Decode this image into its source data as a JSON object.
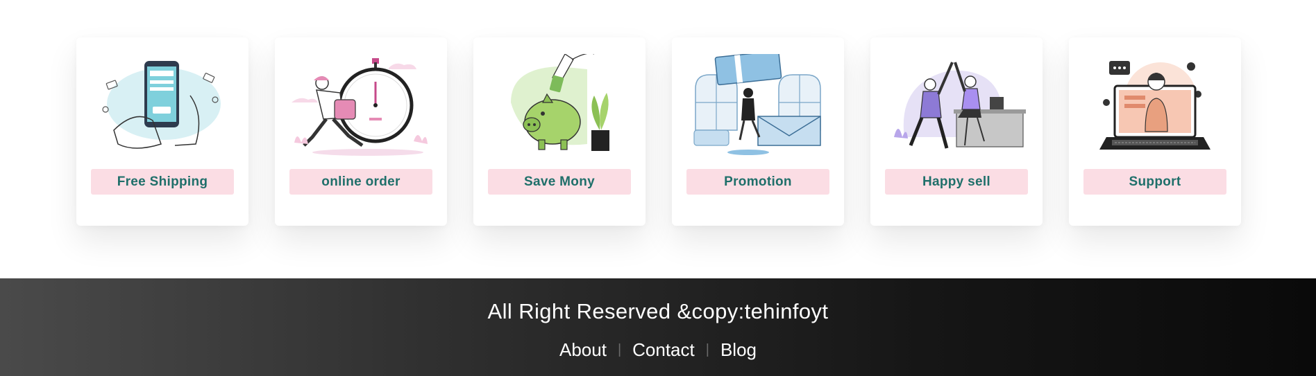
{
  "features": [
    {
      "label": "Free Shipping",
      "icon": "payment-phone-illustration"
    },
    {
      "label": "online order",
      "icon": "delivery-stopwatch-illustration"
    },
    {
      "label": "Save Mony",
      "icon": "piggy-bank-illustration"
    },
    {
      "label": "Promotion",
      "icon": "gift-card-illustration"
    },
    {
      "label": "Happy sell",
      "icon": "high-five-illustration"
    },
    {
      "label": "Support",
      "icon": "laptop-support-illustration"
    }
  ],
  "footer": {
    "copyright": "All Right Reserved &copy:tehinfoyt",
    "links": [
      "About",
      "Contact",
      "Blog"
    ]
  },
  "colors": {
    "label_bg": "#fbdde4",
    "label_text": "#1f6f6a",
    "footer_bg": "#1a1a1a"
  }
}
